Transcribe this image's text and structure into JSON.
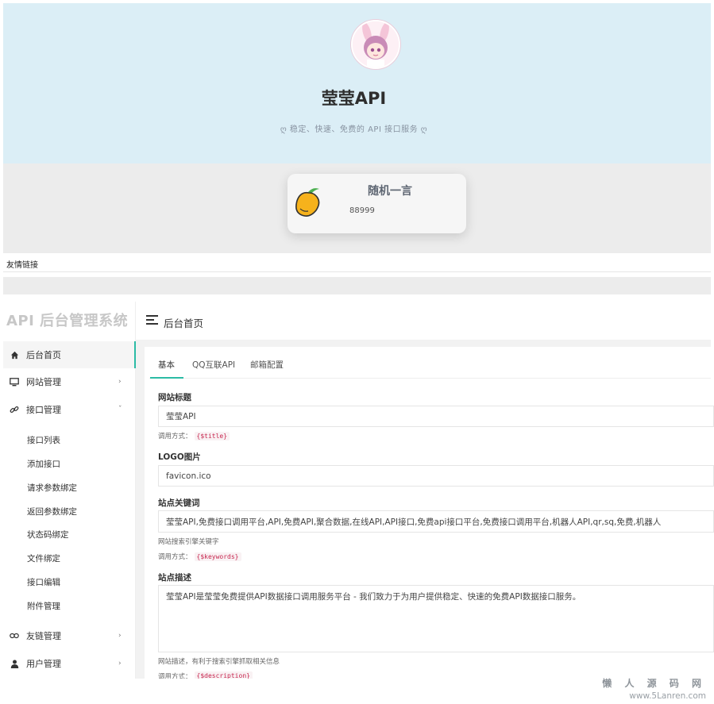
{
  "hero": {
    "title": "莹莹API",
    "subtitle": "ღ 稳定、快速、免费的 API 接口服务 ღ"
  },
  "card": {
    "title": "随机一言",
    "value": "88999",
    "icon": "mango-icon"
  },
  "friend_links": {
    "label": "友情链接"
  },
  "admin": {
    "brand": "API 后台管理系统",
    "page_title": "后台首页",
    "accent_color": "#2bbba5",
    "nav": [
      {
        "label": "后台首页",
        "icon": "home-icon",
        "active": true
      },
      {
        "label": "网站管理",
        "icon": "monitor-icon",
        "arrow": "›"
      },
      {
        "label": "接口管理",
        "icon": "link-icon",
        "arrow": "ˇ"
      },
      {
        "label": "友链管理",
        "icon": "chain-icon",
        "arrow": "›"
      },
      {
        "label": "用户管理",
        "icon": "user-icon",
        "arrow": "›"
      }
    ],
    "sub_nav": [
      "接口列表",
      "添加接口",
      "请求参数绑定",
      "返回参数绑定",
      "状态码绑定",
      "文件绑定",
      "接口编辑",
      "附件管理"
    ],
    "tabs": [
      "基本",
      "QQ互联API",
      "邮箱配置"
    ],
    "form": {
      "site_title": {
        "label": "网站标题",
        "value": "莹莹API",
        "call_label": "调用方式：",
        "call_code": "{$title}"
      },
      "logo": {
        "label": "LOGO图片",
        "value": "favicon.ico"
      },
      "keywords": {
        "label": "站点关键词",
        "value": "莹莹API,免费接口调用平台,API,免费API,聚合数据,在线API,API接口,免费api接口平台,免费接口调用平台,机器人API,qr,sq,免费,机器人",
        "help": "网站搜索引擎关键字",
        "call_label": "调用方式：",
        "call_code": "{$keywords}"
      },
      "description": {
        "label": "站点描述",
        "value": "莹莹API是莹莹免费提供API数据接口调用服务平台 - 我们致力于为用户提供稳定、快速的免费API数据接口服务。",
        "help": "网站描述，有利于搜索引擎抓取相关信息",
        "call_label": "调用方式：",
        "call_code": "{$description}"
      }
    }
  },
  "watermark": {
    "line1": "懒 人 源 码 网",
    "line2": "www.5Lanren.com"
  }
}
